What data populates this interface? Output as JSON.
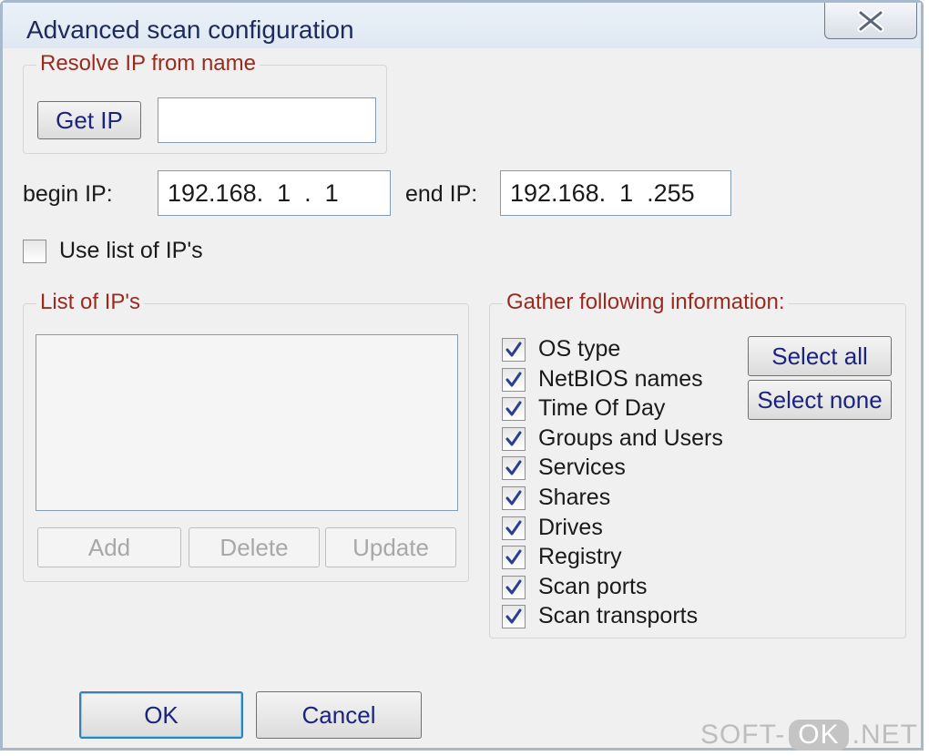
{
  "window": {
    "title": "Advanced scan configuration",
    "close_label": "close"
  },
  "resolve": {
    "legend": "Resolve IP from name",
    "get_ip_label": "Get IP",
    "name_value": ""
  },
  "range": {
    "begin_label": "begin IP:",
    "begin_value": "192.168.  1  .  1",
    "end_label": "end IP:",
    "end_value": "192.168.  1  .255"
  },
  "use_list": {
    "label": "Use list of IP's",
    "checked": false
  },
  "ip_list": {
    "legend": "List of IP's",
    "items": [],
    "add_label": "Add",
    "delete_label": "Delete",
    "update_label": "Update"
  },
  "gather": {
    "legend": "Gather following information:",
    "options": [
      {
        "label": "OS type",
        "checked": true
      },
      {
        "label": "NetBIOS names",
        "checked": true
      },
      {
        "label": "Time Of Day",
        "checked": true
      },
      {
        "label": "Groups and Users",
        "checked": true
      },
      {
        "label": "Services",
        "checked": true
      },
      {
        "label": "Shares",
        "checked": true
      },
      {
        "label": "Drives",
        "checked": true
      },
      {
        "label": "Registry",
        "checked": true
      },
      {
        "label": "Scan ports",
        "checked": true
      },
      {
        "label": "Scan transports",
        "checked": true
      }
    ],
    "select_all_label": "Select all",
    "select_none_label": "Select none"
  },
  "footer": {
    "ok_label": "OK",
    "cancel_label": "Cancel"
  },
  "watermark": {
    "left": "SOFT-",
    "mid": "OK",
    "right": ".NET"
  },
  "colors": {
    "title_text": "#1d2a5c",
    "group_legend": "#9b2a1e",
    "button_text": "#1a237e",
    "check_mark": "#2a3f8f"
  }
}
